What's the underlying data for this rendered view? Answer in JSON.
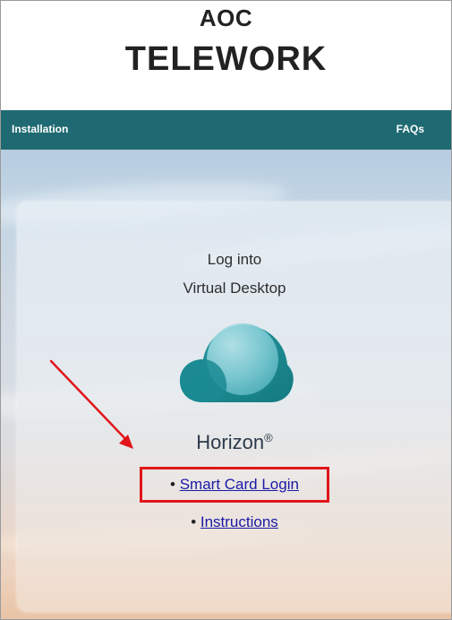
{
  "header": {
    "line1": "AOC",
    "line2": "TELEWORK"
  },
  "nav": {
    "left_link": "Installation",
    "right_link": "FAQs",
    "background": "#1f6a72"
  },
  "card": {
    "title_line1": "Log into",
    "title_line2": "Virtual Desktop",
    "brand_name": "Horizon",
    "brand_mark": "®",
    "logo_icon": "cloud-logo-icon"
  },
  "links": {
    "bullet": "•",
    "smart_card_login": "Smart Card Login",
    "instructions": "Instructions"
  },
  "annotation": {
    "highlight_color": "#e0161b",
    "arrow_color": "#e0161b"
  }
}
